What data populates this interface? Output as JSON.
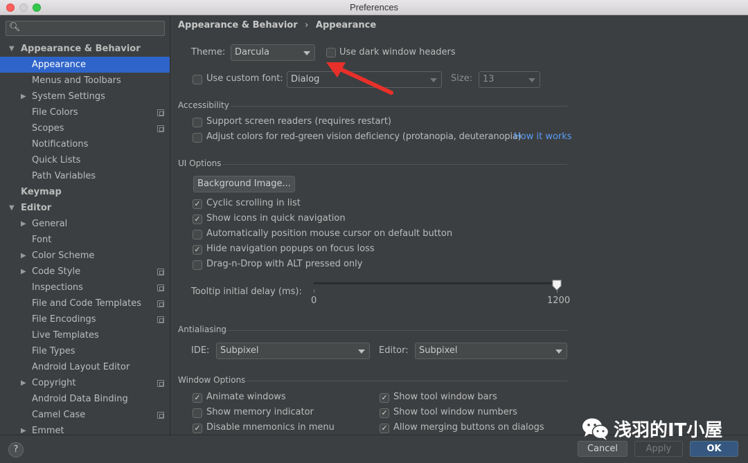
{
  "window": {
    "title": "Preferences"
  },
  "sidebar": {
    "search_icon": "search-icon",
    "items": [
      {
        "label": "Appearance & Behavior",
        "level": 0,
        "arrow": "down"
      },
      {
        "label": "Appearance",
        "level": 1,
        "selected": true
      },
      {
        "label": "Menus and Toolbars",
        "level": 1
      },
      {
        "label": "System Settings",
        "level": 1,
        "arrow": "right"
      },
      {
        "label": "File Colors",
        "level": 1,
        "project": true
      },
      {
        "label": "Scopes",
        "level": 1,
        "project": true
      },
      {
        "label": "Notifications",
        "level": 1
      },
      {
        "label": "Quick Lists",
        "level": 1
      },
      {
        "label": "Path Variables",
        "level": 1
      },
      {
        "label": "Keymap",
        "level": 0
      },
      {
        "label": "Editor",
        "level": 0,
        "arrow": "down"
      },
      {
        "label": "General",
        "level": 1,
        "arrow": "right"
      },
      {
        "label": "Font",
        "level": 1
      },
      {
        "label": "Color Scheme",
        "level": 1,
        "arrow": "right"
      },
      {
        "label": "Code Style",
        "level": 1,
        "arrow": "right",
        "project": true
      },
      {
        "label": "Inspections",
        "level": 1,
        "project": true
      },
      {
        "label": "File and Code Templates",
        "level": 1,
        "project": true
      },
      {
        "label": "File Encodings",
        "level": 1,
        "project": true
      },
      {
        "label": "Live Templates",
        "level": 1
      },
      {
        "label": "File Types",
        "level": 1
      },
      {
        "label": "Android Layout Editor",
        "level": 1
      },
      {
        "label": "Copyright",
        "level": 1,
        "arrow": "right",
        "project": true
      },
      {
        "label": "Android Data Binding",
        "level": 1
      },
      {
        "label": "Camel Case",
        "level": 1,
        "project": true
      },
      {
        "label": "Emmet",
        "level": 1,
        "arrow": "right"
      }
    ]
  },
  "breadcrumb": {
    "parent": "Appearance & Behavior",
    "separator": "›",
    "current": "Appearance"
  },
  "theme": {
    "label": "Theme:",
    "value": "Darcula",
    "dark_headers_label": "Use dark window headers",
    "dark_headers_checked": false
  },
  "custom_font": {
    "label": "Use custom font:",
    "checked": false,
    "value": "Dialog",
    "size_label": "Size:",
    "size_value": "13"
  },
  "accessibility": {
    "title": "Accessibility",
    "screen_readers": {
      "label": "Support screen readers (requires restart)",
      "checked": false
    },
    "color_deficiency": {
      "label": "Adjust colors for red-green vision deficiency (protanopia, deuteranopia)",
      "checked": false
    },
    "how_it_works": "How it works"
  },
  "ui_options": {
    "title": "UI Options",
    "background_button": "Background Image...",
    "options": [
      {
        "label": "Cyclic scrolling in list",
        "checked": true
      },
      {
        "label": "Show icons in quick navigation",
        "checked": true
      },
      {
        "label": "Automatically position mouse cursor on default button",
        "checked": false
      },
      {
        "label": "Hide navigation popups on focus loss",
        "checked": true
      },
      {
        "label": "Drag-n-Drop with ALT pressed only",
        "checked": false
      }
    ],
    "tooltip": {
      "label": "Tooltip initial delay (ms):",
      "min": "0",
      "max": "1200",
      "value": 1200
    }
  },
  "antialiasing": {
    "title": "Antialiasing",
    "ide_label": "IDE:",
    "ide_value": "Subpixel",
    "editor_label": "Editor:",
    "editor_value": "Subpixel"
  },
  "window_options": {
    "title": "Window Options",
    "left": [
      {
        "label": "Animate windows",
        "checked": true
      },
      {
        "label": "Show memory indicator",
        "checked": false
      },
      {
        "label": "Disable mnemonics in menu",
        "checked": true
      }
    ],
    "right": [
      {
        "label": "Show tool window bars",
        "checked": true
      },
      {
        "label": "Show tool window numbers",
        "checked": true
      },
      {
        "label": "Allow merging buttons on dialogs",
        "checked": true
      }
    ]
  },
  "dialog": {
    "help": "?",
    "cancel": "Cancel",
    "apply": "Apply",
    "ok": "OK"
  },
  "watermark": {
    "text": "浅羽的IT小屋"
  },
  "colors": {
    "selection": "#2f65ca",
    "link": "#589df6",
    "ok_button": "#365880",
    "annotation_arrow": "#e8302a"
  }
}
